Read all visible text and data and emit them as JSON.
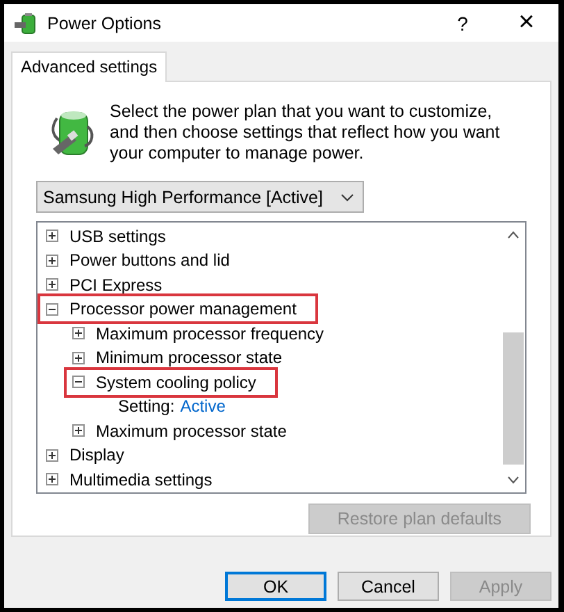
{
  "window": {
    "title": "Power Options",
    "help": "?",
    "close": "×"
  },
  "tabs": [
    {
      "label": "Advanced settings",
      "selected": true
    }
  ],
  "description": "Select the power plan that you want to customize, and then choose settings that reflect how you want your computer to manage power.",
  "plan_dropdown": {
    "value": "Samsung High Performance [Active]"
  },
  "tree": {
    "items": [
      {
        "kind": "group",
        "label": "USB settings",
        "expanded": false,
        "highlighted": false
      },
      {
        "kind": "group",
        "label": "Power buttons and lid",
        "expanded": false,
        "highlighted": false
      },
      {
        "kind": "group",
        "label": "PCI Express",
        "expanded": false,
        "highlighted": false
      },
      {
        "kind": "group",
        "label": "Processor power management",
        "expanded": true,
        "highlighted": true,
        "children": [
          {
            "kind": "group",
            "label": "Maximum processor frequency",
            "expanded": false,
            "highlighted": false
          },
          {
            "kind": "group",
            "label": "Minimum processor state",
            "expanded": false,
            "highlighted": false
          },
          {
            "kind": "group",
            "label": "System cooling policy",
            "expanded": true,
            "highlighted": true,
            "children": [
              {
                "kind": "setting",
                "label": "Setting:",
                "value": "Active"
              }
            ]
          },
          {
            "kind": "group",
            "label": "Maximum processor state",
            "expanded": false,
            "highlighted": false
          }
        ]
      },
      {
        "kind": "group",
        "label": "Display",
        "expanded": false,
        "highlighted": false
      },
      {
        "kind": "group",
        "label": "Multimedia settings",
        "expanded": false,
        "highlighted": false
      }
    ]
  },
  "restore_button": {
    "label": "Restore plan defaults",
    "disabled": true
  },
  "buttons": [
    {
      "label": "OK",
      "default": true,
      "disabled": false
    },
    {
      "label": "Cancel",
      "default": false,
      "disabled": false
    },
    {
      "label": "Apply",
      "default": false,
      "disabled": true
    }
  ]
}
